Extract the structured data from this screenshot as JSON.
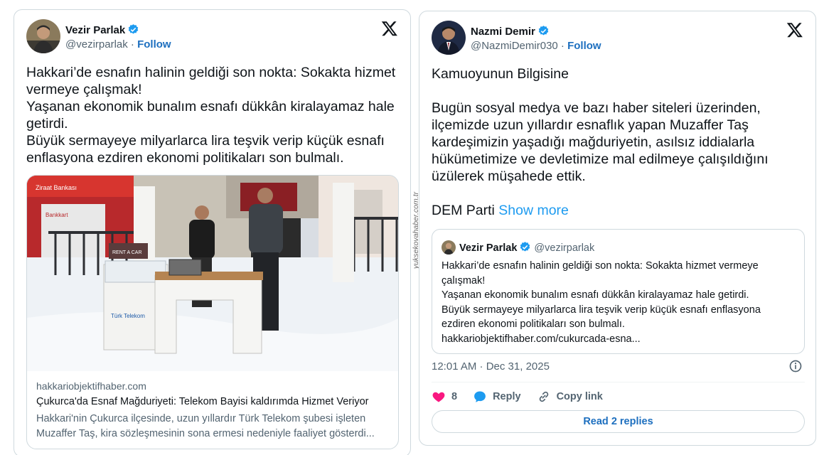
{
  "left_tweet": {
    "author_name": "Vezir Parlak",
    "handle": "@vezirparlak",
    "separator": " · ",
    "follow_label": "Follow",
    "text": "Hakkari’de esnafın halinin geldiği son nokta: Sokakta hizmet vermeye çalışmak!\nYaşanan ekonomik bunalım esnafı dükkân kiralayamaz hale getirdi.\nBüyük sermayeye milyarlarca lira teşvik verip küçük esnafı enflasyona ezdiren ekonomi politikaları son bulmalı.",
    "link_card": {
      "domain": "hakkariobjektifhaber.com",
      "title": "Çukurca'da Esnaf Mağduriyeti: Telekom Bayisi kaldırımda Hizmet Veriyor",
      "description": "Hakkari'nin Çukurca ilçesinde, uzun yıllardır Türk Telekom şubesi işleten\nMuzaffer Taş, kira sözleşmesinin sona ermesi nedeniyle faaliyet gösterdi..."
    },
    "photo_signs": {
      "bank": "Ziraat Bankası",
      "bankkart": "Bankkart",
      "kiosk": "Türk Telekom",
      "rent": "RENT A CAR"
    }
  },
  "right_tweet": {
    "author_name": "Nazmi Demir",
    "handle": "@NazmiDemir030",
    "separator": " · ",
    "follow_label": "Follow",
    "text": "Kamuoyunun Bilgisine\n\nBugün sosyal medya ve bazı haber siteleri üzerinden, ilçemizde uzun yıllardır esnaflık yapan Muzaffer Taş kardeşimizin yaşadığı mağduriyetin, asılsız iddialarla hükümetimize ve devletimize mal edilmeye çalışıldığını üzülerek müşahede ettik.\n\nDEM Parti ",
    "show_more_label": "Show more",
    "quote": {
      "author_name": "Vezir Parlak",
      "handle": "@vezirparlak",
      "text": "Hakkari’de esnafın halinin geldiği son nokta: Sokakta hizmet vermeye çalışmak!\nYaşanan ekonomik bunalım esnafı dükkân kiralayamaz hale getirdi.\nBüyük sermayeye milyarlarca lira teşvik verip küçük esnafı enflasyona ezdiren ekonomi politikaları son bulmalı.\nhakkariobjektifhaber.com/cukurcada-esna..."
    },
    "timestamp": "12:01 AM · Dec 31, 2025",
    "like_count": "8",
    "reply_label": "Reply",
    "copy_link_label": "Copy link",
    "read_replies_label": "Read 2 replies"
  },
  "watermark": "yuksekovahaber.com.tr",
  "colors": {
    "accent_blue": "#1d9bf0",
    "follow_blue": "#1d6fbf",
    "like_red": "#f91880",
    "border": "#cfd9de",
    "secondary_text": "#536471"
  },
  "icons": [
    "verified-badge-icon",
    "x-logo-icon",
    "info-icon",
    "heart-icon",
    "reply-bubble-icon",
    "link-icon"
  ]
}
